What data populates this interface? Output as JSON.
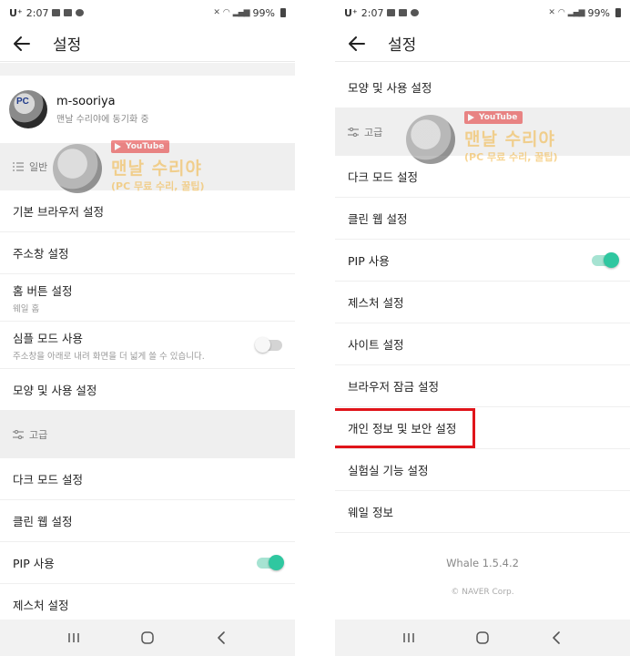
{
  "status_bar": {
    "time": "2:07",
    "carrier": "U⁺",
    "battery": "99%"
  },
  "app_bar": {
    "title": "설정"
  },
  "profile": {
    "name": "m-sooriya",
    "subtitle": "맨날 수리야에 동기화 중"
  },
  "watermark": {
    "badge": "YouTube",
    "title": "맨날 수리야",
    "subtitle": "(PC 무료 수리, 꿀팁)"
  },
  "left_screen": {
    "section_general": "일반",
    "items_general": [
      {
        "label": "기본 브라우저 설정"
      },
      {
        "label": "주소창 설정"
      },
      {
        "label": "홈 버튼 설정",
        "sub": "웨일 홈"
      },
      {
        "label": "심플 모드 사용",
        "sub": "주소창을 아래로 내려 화면을 더 넓게 쓸 수 있습니다.",
        "toggle": "off"
      },
      {
        "label": "모양 및 사용 설정"
      }
    ],
    "section_advanced": "고급",
    "items_advanced": [
      {
        "label": "다크 모드 설정"
      },
      {
        "label": "클린 웹 설정"
      },
      {
        "label": "PIP 사용",
        "toggle": "on"
      },
      {
        "label": "제스처 설정"
      }
    ]
  },
  "right_screen": {
    "items_top": [
      {
        "label": "모양 및 사용 설정"
      }
    ],
    "section_advanced": "고급",
    "items_advanced": [
      {
        "label": "다크 모드 설정"
      },
      {
        "label": "클린 웹 설정"
      },
      {
        "label": "PIP 사용",
        "toggle": "on"
      },
      {
        "label": "제스처 설정"
      },
      {
        "label": "사이트 설정"
      },
      {
        "label": "브라우저 잠금 설정"
      },
      {
        "label": "개인 정보 및 보안 설정",
        "highlighted": true
      },
      {
        "label": "실험실 기능 설정"
      },
      {
        "label": "웨일 정보"
      }
    ],
    "footer": {
      "version": "Whale 1.5.4.2",
      "copyright": "© NAVER Corp."
    }
  },
  "colors": {
    "toggle_on": "#2fc7a0",
    "highlight": "#e0141a",
    "section_bg": "#efefef"
  },
  "icons": [
    "back-arrow-icon",
    "list-icon",
    "sliders-icon",
    "recents-icon",
    "home-icon",
    "nav-back-icon"
  ]
}
